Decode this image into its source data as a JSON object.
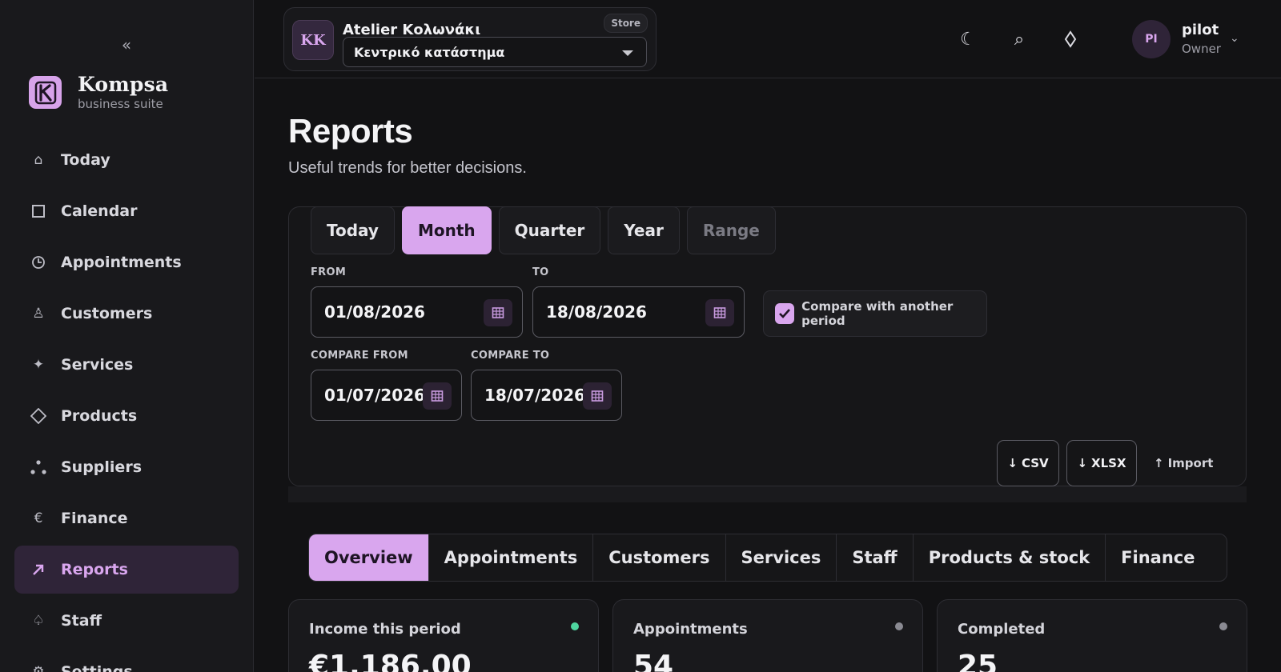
{
  "sidebar": {
    "collapse_icon": "double-chevron-left-icon",
    "brand": {
      "name": "Kompsa",
      "subtitle": "business suite",
      "accent": "#d9a6ee"
    },
    "items": [
      {
        "label": "Today",
        "icon": "home-icon",
        "active": false
      },
      {
        "label": "Calendar",
        "icon": "calendar-icon",
        "active": false
      },
      {
        "label": "Appointments",
        "icon": "clock-icon",
        "active": false
      },
      {
        "label": "Customers",
        "icon": "person-icon",
        "active": false
      },
      {
        "label": "Services",
        "icon": "sparkle-icon",
        "active": false
      },
      {
        "label": "Products",
        "icon": "diamond-icon",
        "active": false
      },
      {
        "label": "Suppliers",
        "icon": "dots-icon",
        "active": false
      },
      {
        "label": "Finance",
        "icon": "euro-icon",
        "active": false
      },
      {
        "label": "Reports",
        "icon": "arrow-up-right-icon",
        "active": true
      },
      {
        "label": "Staff",
        "icon": "user-icon",
        "active": false
      },
      {
        "label": "Settings",
        "icon": "gear-icon",
        "active": false
      }
    ]
  },
  "header": {
    "store": {
      "initials": "KK",
      "name": "Atelier Κολωνάκι",
      "badge": "Store",
      "selected_branch": "Κεντρικό κατάστημα"
    },
    "icons": [
      "moon-icon",
      "search-icon",
      "diamond-icon"
    ],
    "user": {
      "initials": "PI",
      "name": "pilot",
      "role": "Owner"
    }
  },
  "page": {
    "title": "Reports",
    "subtitle": "Useful trends for better decisions."
  },
  "filters": {
    "period_tabs": [
      {
        "label": "Today",
        "state": "normal"
      },
      {
        "label": "Month",
        "state": "active"
      },
      {
        "label": "Quarter",
        "state": "normal"
      },
      {
        "label": "Year",
        "state": "normal"
      },
      {
        "label": "Range",
        "state": "disabled"
      }
    ],
    "from_label": "FROM",
    "from_value": "01/08/2026",
    "to_label": "TO",
    "to_value": "18/08/2026",
    "compare_checked": true,
    "compare_label": "Compare with another period",
    "compare_from_label": "COMPARE FROM",
    "compare_from_value": "01/07/2026",
    "compare_to_label": "COMPARE TO",
    "compare_to_value": "18/07/2026",
    "export_csv": "CSV",
    "export_xlsx": "XLSX",
    "import_label": "Import"
  },
  "report_tabs": [
    {
      "label": "Overview",
      "active": true
    },
    {
      "label": "Appointments",
      "active": false
    },
    {
      "label": "Customers",
      "active": false
    },
    {
      "label": "Services",
      "active": false
    },
    {
      "label": "Staff",
      "active": false
    },
    {
      "label": "Products & stock",
      "active": false
    },
    {
      "label": "Finance",
      "active": false
    }
  ],
  "kpis": [
    {
      "label": "Income this period",
      "value": "€1,186.00",
      "status_color": "#4fd6a0"
    },
    {
      "label": "Appointments",
      "value": "54",
      "status_color": "#8a8a92"
    },
    {
      "label": "Completed",
      "value": "25",
      "status_color": "#8a8a92"
    }
  ]
}
